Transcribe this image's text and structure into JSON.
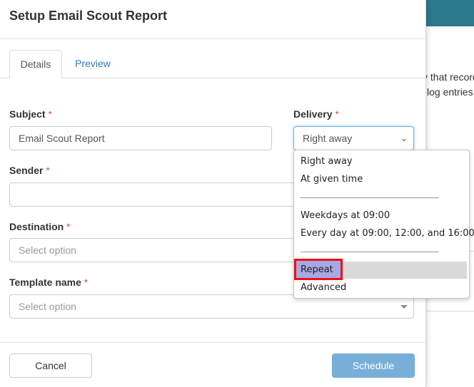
{
  "background": {
    "text_line1": "y that record",
    "text_line2": "log entries"
  },
  "modal": {
    "title": "Setup Email Scout Report",
    "tabs": [
      {
        "label": "Details",
        "active": true
      },
      {
        "label": "Preview",
        "active": false
      }
    ],
    "fields": {
      "subject": {
        "label": "Subject",
        "required_mark": "*",
        "value": "Email Scout Report"
      },
      "delivery": {
        "label": "Delivery",
        "required_mark": "*",
        "value": "Right away"
      },
      "sender": {
        "label": "Sender",
        "required_mark": "*",
        "value": ""
      },
      "destination": {
        "label": "Destination",
        "required_mark": "*",
        "placeholder": "Select option"
      },
      "template": {
        "label": "Template name",
        "required_mark": "*",
        "placeholder": "Select option"
      }
    },
    "buttons": {
      "cancel": "Cancel",
      "schedule": "Schedule"
    }
  },
  "delivery_dropdown": {
    "options": [
      "Right away",
      "At given time",
      "Weekdays at 09:00",
      "Every day at 09:00, 12:00, and 16:00",
      "Repeat",
      "Advanced"
    ],
    "selected": "Repeat"
  },
  "colors": {
    "required": "#d9534f",
    "link": "#337ab7",
    "primary_button": "#78afd9",
    "highlight_border": "#ee1111",
    "highlight_fill": "#a7a9e6"
  }
}
